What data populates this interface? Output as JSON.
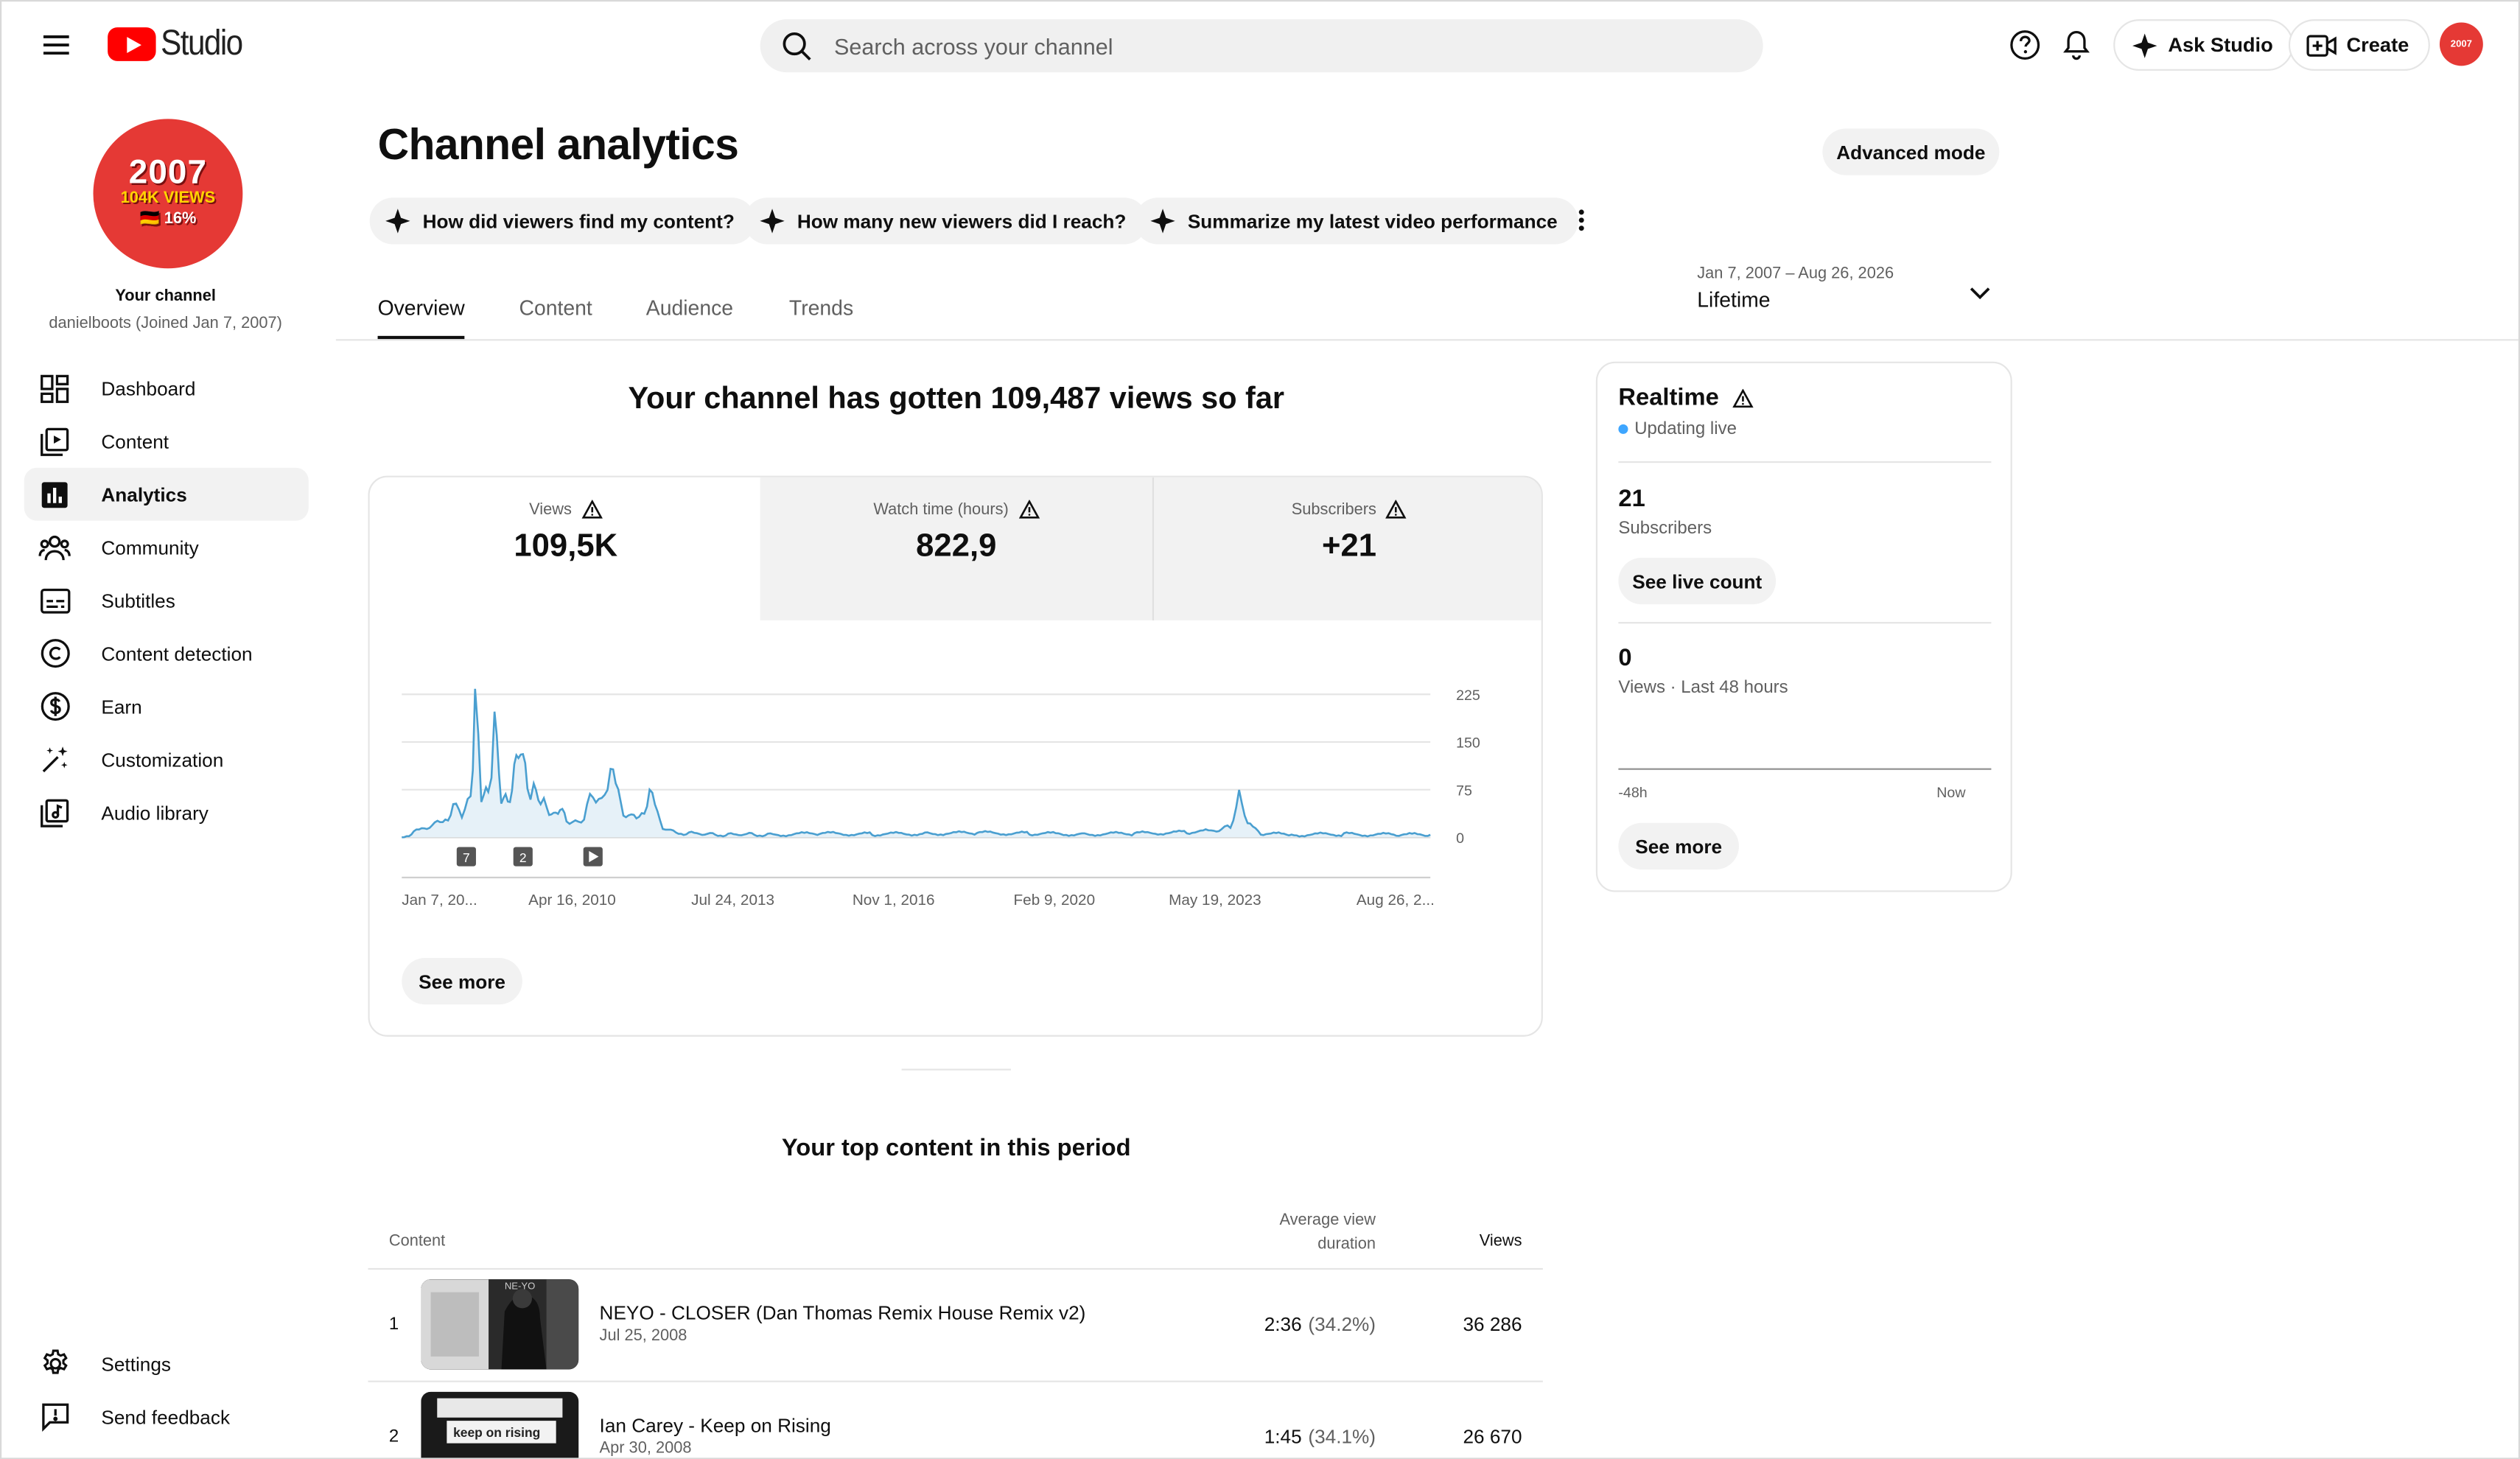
{
  "header": {
    "logo_text": "Studio",
    "search_placeholder": "Search across your channel",
    "ask_studio_label": "Ask Studio",
    "create_label": "Create",
    "avatar_text": "2007"
  },
  "sidebar": {
    "channel_title": "Your channel",
    "channel_sub": "danielboots (Joined Jan 7, 2007)",
    "avatar_line1": "2007",
    "avatar_line2": "104K VIEWS",
    "avatar_line3": "🇩🇪 16%",
    "items": [
      {
        "label": "Dashboard",
        "icon": "dashboard-icon"
      },
      {
        "label": "Content",
        "icon": "content-icon"
      },
      {
        "label": "Analytics",
        "icon": "analytics-icon",
        "active": true
      },
      {
        "label": "Community",
        "icon": "community-icon"
      },
      {
        "label": "Subtitles",
        "icon": "subtitles-icon"
      },
      {
        "label": "Content detection",
        "icon": "copyright-icon"
      },
      {
        "label": "Earn",
        "icon": "dollar-icon"
      },
      {
        "label": "Customization",
        "icon": "magic-wand-icon"
      },
      {
        "label": "Audio library",
        "icon": "audio-library-icon"
      }
    ],
    "bottom_items": [
      {
        "label": "Settings",
        "icon": "gear-icon"
      },
      {
        "label": "Send feedback",
        "icon": "feedback-icon"
      }
    ]
  },
  "main": {
    "title": "Channel analytics",
    "advanced_mode_label": "Advanced mode",
    "chips": [
      "How did viewers find my content?",
      "How many new viewers did I reach?",
      "Summarize my latest video performance"
    ],
    "tabs": [
      "Overview",
      "Content",
      "Audience",
      "Trends"
    ],
    "date_range": "Jan 7, 2007 – Aug 26, 2026",
    "date_label": "Lifetime",
    "headline": "Your channel has gotten 109,487 views so far",
    "metrics": [
      {
        "label": "Views",
        "value": "109,5K"
      },
      {
        "label": "Watch time (hours)",
        "value": "822,9"
      },
      {
        "label": "Subscribers",
        "value": "+21"
      }
    ],
    "see_more_label": "See more",
    "top_content_title": "Your top content in this period",
    "table_headers": {
      "content": "Content",
      "avd_line1": "Average view",
      "avd_line2": "duration",
      "views": "Views"
    },
    "rows": [
      {
        "rank": "1",
        "title": "NEYO - CLOSER (Dan Thomas Remix House Remix v2)",
        "date": "Jul 25, 2008",
        "avd": "2:36",
        "avd_pct": "(34.2%)",
        "views": "36 286",
        "thumb_text": "NE-YO"
      },
      {
        "rank": "2",
        "title": "Ian Carey - Keep on Rising",
        "date": "Apr 30, 2008",
        "avd": "1:45",
        "avd_pct": "(34.1%)",
        "views": "26 670",
        "thumb_text": "keep on rising"
      }
    ]
  },
  "realtime": {
    "title": "Realtime",
    "live_label": "Updating live",
    "subs_value": "21",
    "subs_label": "Subscribers",
    "live_count_label": "See live count",
    "views_value": "0",
    "views_label": "Views · Last 48 hours",
    "axis_start": "-48h",
    "axis_end": "Now",
    "see_more_label": "See more"
  },
  "chart_data": {
    "type": "area",
    "title": "",
    "xlabel": "",
    "ylabel": "",
    "x_range": [
      "2007-01-07",
      "2026-08-26"
    ],
    "x_tick_labels": [
      "Jan 7, 20...",
      "Apr 16, 2010",
      "Jul 24, 2013",
      "Nov 1, 2016",
      "Feb 9, 2020",
      "May 19, 2023",
      "Aug 26, 2..."
    ],
    "y_ticks": [
      0,
      75,
      150,
      225
    ],
    "ylim": [
      0,
      225
    ],
    "color": "#4a9fd0",
    "grid": true,
    "markers": [
      {
        "label": "7",
        "date": "2008-04-01"
      },
      {
        "label": "2",
        "date": "2009-05-01"
      },
      {
        "label": "play",
        "date": "2010-09-01"
      }
    ],
    "series": [
      {
        "x": [
          "2007-01-07",
          "2007-04-01",
          "2007-07-01",
          "2007-10-01",
          "2008-01-01",
          "2008-03-01",
          "2008-05-01",
          "2008-06-01",
          "2008-07-15",
          "2008-09-01",
          "2008-10-15",
          "2008-12-01",
          "2009-01-15",
          "2009-03-01",
          "2009-04-15",
          "2009-06-01",
          "2009-07-15",
          "2009-09-01",
          "2009-10-15",
          "2009-12-01",
          "2010-01-15",
          "2010-03-01",
          "2010-05-01",
          "2010-07-01",
          "2010-09-01",
          "2010-11-01",
          "2011-01-01",
          "2011-04-01",
          "2011-07-01",
          "2011-10-01",
          "2012-01-01",
          "2012-04-01",
          "2012-07-01",
          "2012-10-01",
          "2013-01-01",
          "2013-04-01",
          "2013-07-01",
          "2013-10-01",
          "2014-01-01",
          "2015-01-01",
          "2016-01-01",
          "2017-01-01",
          "2018-01-01",
          "2019-01-01",
          "2020-01-01",
          "2021-01-01",
          "2022-01-01",
          "2022-06-01",
          "2022-09-01",
          "2022-11-01",
          "2023-01-01",
          "2023-03-01",
          "2023-06-01",
          "2024-01-01",
          "2025-01-01",
          "2026-01-01",
          "2026-08-26"
        ],
        "values": [
          0,
          8,
          15,
          25,
          45,
          35,
          70,
          200,
          60,
          80,
          170,
          55,
          65,
          100,
          130,
          90,
          75,
          50,
          55,
          35,
          40,
          30,
          25,
          25,
          75,
          60,
          95,
          40,
          30,
          65,
          15,
          8,
          6,
          5,
          5,
          4,
          4,
          5,
          4,
          6,
          5,
          6,
          7,
          6,
          5,
          6,
          8,
          10,
          12,
          18,
          70,
          20,
          6,
          4,
          5,
          4,
          4
        ]
      }
    ]
  }
}
